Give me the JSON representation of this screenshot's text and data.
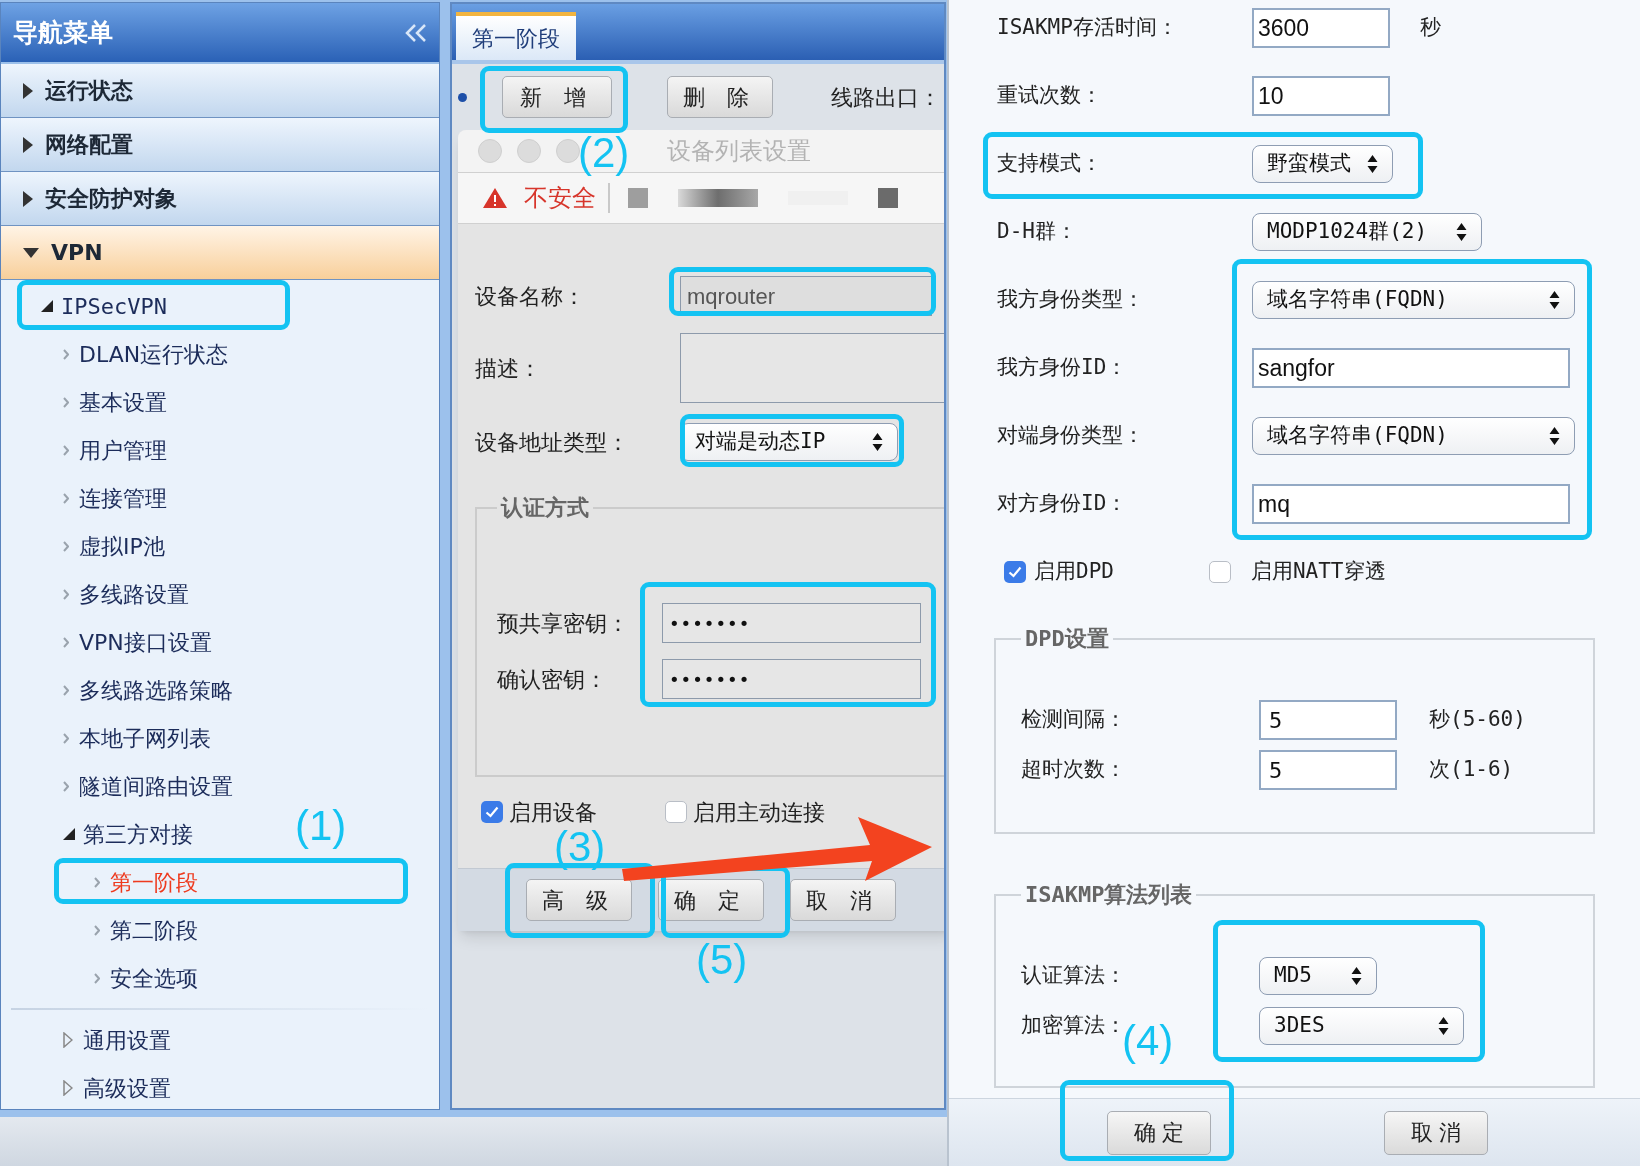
{
  "sidebar": {
    "title": "导航菜单",
    "sections": [
      {
        "label": "运行状态",
        "expanded": false
      },
      {
        "label": "网络配置",
        "expanded": false
      },
      {
        "label": "安全防护对象",
        "expanded": false
      },
      {
        "label": "VPN",
        "expanded": true,
        "children": [
          {
            "label": "IPSecVPN",
            "expanded": true,
            "children": [
              {
                "label": "DLAN运行状态",
                "selected": false
              },
              {
                "label": "基本设置",
                "selected": false
              },
              {
                "label": "用户管理",
                "selected": false
              },
              {
                "label": "连接管理",
                "selected": false
              },
              {
                "label": "虚拟IP池",
                "selected": false
              },
              {
                "label": "多线路设置",
                "selected": false
              },
              {
                "label": "VPN接口设置",
                "selected": false
              },
              {
                "label": "多线路选路策略",
                "selected": false
              },
              {
                "label": "本地子网列表",
                "selected": false
              },
              {
                "label": "隧道间路由设置",
                "selected": false
              },
              {
                "label": "第三方对接",
                "expanded": true,
                "children": [
                  {
                    "label": "第一阶段",
                    "selected": true
                  },
                  {
                    "label": "第二阶段",
                    "selected": false
                  },
                  {
                    "label": "安全选项",
                    "selected": false
                  }
                ]
              }
            ]
          }
        ],
        "folders": [
          {
            "label": "通用设置",
            "expanded": false
          },
          {
            "label": "高级设置",
            "expanded": false
          }
        ]
      }
    ]
  },
  "tabs": [
    {
      "label": "第一阶段",
      "selected": true
    }
  ],
  "toolbar": {
    "buttons": [
      "新 增",
      "删 除"
    ],
    "label": "线路出口："
  },
  "device_dialog": {
    "title": "设备列表设置",
    "security": "不安全",
    "rows": [
      {
        "kind": "input",
        "label": "设备名称：",
        "value": "mqrouter",
        "disabled": true
      },
      {
        "kind": "textarea",
        "label": "描述："
      },
      {
        "kind": "select",
        "label": "设备地址类型：",
        "value": "对端是动态IP"
      }
    ],
    "auth": {
      "legend": "认证方式",
      "rows": [
        {
          "label": "预共享密钥：",
          "value": "•••••••"
        },
        {
          "label": "确认密钥：",
          "value": "•••••••"
        }
      ]
    },
    "checkboxes": [
      {
        "label": "启用设备",
        "checked": true
      },
      {
        "label": "启用主动连接",
        "checked": false
      }
    ],
    "buttons": [
      "高 级",
      "确 定",
      "取 消"
    ]
  },
  "phase1_dialog": {
    "rows": [
      {
        "kind": "input",
        "label": "ISAKMP存活时间：",
        "value": "3600",
        "unit": "秒"
      },
      {
        "kind": "input",
        "label": "重试次数：",
        "value": "10"
      },
      {
        "kind": "select",
        "label": "支持模式：",
        "value": "野蛮模式"
      },
      {
        "kind": "select",
        "label": "D-H群：",
        "value": "MODP1024群(2)"
      },
      {
        "kind": "select",
        "label": "我方身份类型：",
        "value": "域名字符串(FQDN)"
      },
      {
        "kind": "input",
        "label": "我方身份ID：",
        "value": "sangfor"
      },
      {
        "kind": "select",
        "label": "对端身份类型：",
        "value": "域名字符串(FQDN)"
      },
      {
        "kind": "input",
        "label": "对方身份ID：",
        "value": "mq"
      }
    ],
    "checkboxes": [
      {
        "label": "启用DPD",
        "checked": true
      },
      {
        "label": "启用NATT穿透",
        "checked": false
      }
    ],
    "dpd": {
      "legend": "DPD设置",
      "rows": [
        {
          "label": "检测间隔：",
          "value": "5",
          "unit": "秒(5-60)"
        },
        {
          "label": "超时次数：",
          "value": "5",
          "unit": "次(1-6)"
        }
      ]
    },
    "algorithms": {
      "legend": "ISAKMP算法列表",
      "rows": [
        {
          "label": "认证算法：",
          "value": "MD5"
        },
        {
          "label": "加密算法：",
          "value": "3DES"
        }
      ]
    },
    "buttons": [
      "确 定",
      "取 消"
    ]
  },
  "callouts": [
    {
      "label": "(1)"
    },
    {
      "label": "(2)"
    },
    {
      "label": "(3)"
    },
    {
      "label": "(4)"
    },
    {
      "label": "(5)"
    }
  ]
}
